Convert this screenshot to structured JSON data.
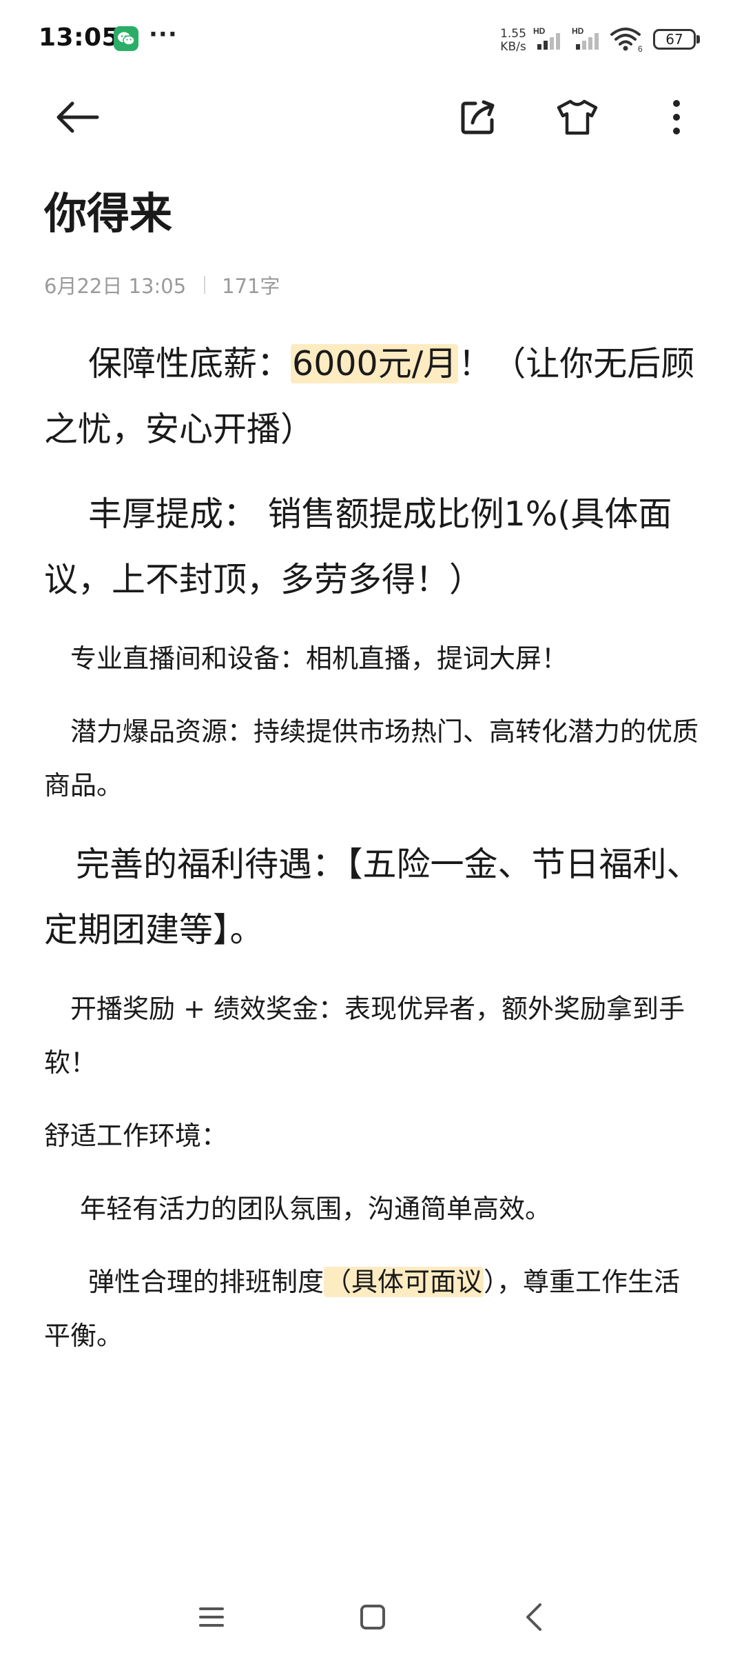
{
  "status_bar": {
    "time": "13:05",
    "more": "···",
    "net_speed_value": "1.55",
    "net_speed_unit": "KB/s",
    "signal_label_1": "HD",
    "signal_label_2": "HD",
    "wifi_label": "6",
    "battery": "67"
  },
  "note": {
    "title": "你得来",
    "date": "6月22日 13:05",
    "word_count": "171字",
    "paragraphs": {
      "p1_pre": "保障性底薪：",
      "p1_hl": "6000元/月",
      "p1_post": "！（让你无后顾之忧，安心开播）",
      "p2": "丰厚提成：  销售额提成比例1%(具体面议，上不封顶，多劳多得！）",
      "p3": "专业直播间和设备：相机直播，提词大屏！",
      "p4": "潜力爆品资源：持续提供市场热门、高转化潜力的优质商品。",
      "p5": "完善的福利待遇：【五险一金、节日福利、定期团建等】。",
      "p6": "开播奖励 + 绩效奖金：表现优异者，额外奖励拿到手软！",
      "p7": "舒适工作环境：",
      "p8": "年轻有活力的团队氛围，沟通简单高效。",
      "p9_pre": "弹性合理的排班制度",
      "p9_hl": "（具体可面议",
      "p9_post": "），尊重工作生活平衡。"
    }
  },
  "colors": {
    "highlight": "#fdebc2",
    "wechat": "#2aae67",
    "meta_text": "#9a9a9a"
  },
  "icons": {
    "back": "arrow-left-icon",
    "share": "share-external-icon",
    "theme": "tshirt-icon",
    "more": "more-vertical-icon",
    "nav_menu": "menu-lines-icon",
    "nav_home": "square-home-icon",
    "nav_back": "chevron-left-icon"
  }
}
